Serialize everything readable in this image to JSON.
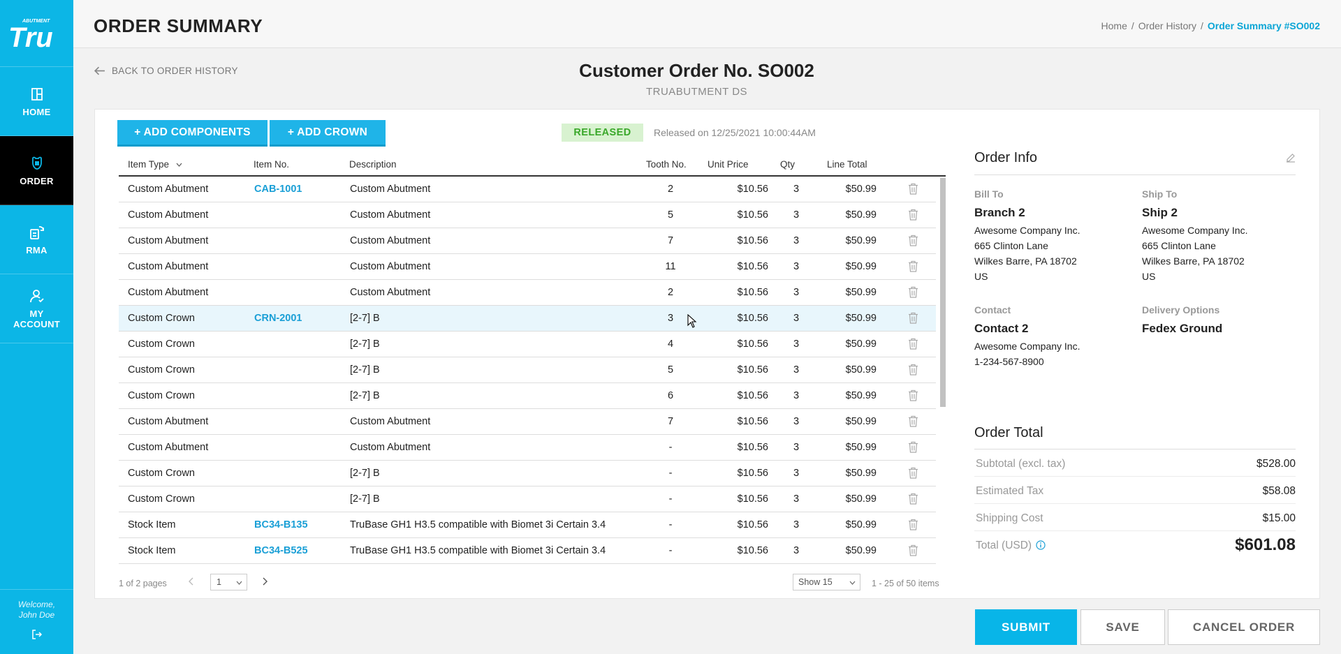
{
  "brand": {
    "logo_text": "Tru",
    "logo_small": "ABUTMENT",
    "accent": "#0cb6e6",
    "link_color": "#1a9fd6"
  },
  "nav": {
    "items": [
      {
        "label": "HOME",
        "icon": "home-icon"
      },
      {
        "label": "ORDER",
        "icon": "order-icon",
        "active": true
      },
      {
        "label": "RMA",
        "icon": "rma-icon"
      },
      {
        "label": "MY ACCOUNT",
        "icon": "account-icon"
      }
    ],
    "welcome_line1": "Welcome,",
    "welcome_line2": "John Doe"
  },
  "header": {
    "title": "ORDER SUMMARY",
    "breadcrumb": [
      "Home",
      "Order History",
      "Order Summary #SO002"
    ],
    "breadcrumb_sep": "/"
  },
  "subheader": {
    "back_label": "BACK TO ORDER HISTORY",
    "order_title": "Customer Order No. SO002",
    "customer": "TRUABUTMENT DS"
  },
  "toolbar": {
    "add_components": "+ ADD COMPONENTS",
    "add_crown": "+ ADD CROWN",
    "status": "RELEASED",
    "status_color": "#3aa82a",
    "released_on": "Released on 12/25/2021 10:00:44AM"
  },
  "table": {
    "headers": {
      "item_type": "Item Type",
      "item_no": "Item No.",
      "description": "Description",
      "tooth_no": "Tooth No.",
      "unit_price": "Unit Price",
      "qty": "Qty",
      "line_total": "Line Total"
    },
    "rows": [
      {
        "type": "Custom Abutment",
        "item": "CAB-1001",
        "desc": "Custom Abutment",
        "tooth": "2",
        "price": "$10.56",
        "qty": "3",
        "total": "$50.99"
      },
      {
        "type": "Custom Abutment",
        "item": "",
        "desc": "Custom Abutment",
        "tooth": "5",
        "price": "$10.56",
        "qty": "3",
        "total": "$50.99"
      },
      {
        "type": "Custom Abutment",
        "item": "",
        "desc": "Custom Abutment",
        "tooth": "7",
        "price": "$10.56",
        "qty": "3",
        "total": "$50.99"
      },
      {
        "type": "Custom Abutment",
        "item": "",
        "desc": "Custom Abutment",
        "tooth": "11",
        "price": "$10.56",
        "qty": "3",
        "total": "$50.99"
      },
      {
        "type": "Custom Abutment",
        "item": "",
        "desc": "Custom Abutment",
        "tooth": "2",
        "price": "$10.56",
        "qty": "3",
        "total": "$50.99"
      },
      {
        "type": "Custom Crown",
        "item": "CRN-2001",
        "desc": "[2-7] B",
        "tooth": "3",
        "price": "$10.56",
        "qty": "3",
        "total": "$50.99",
        "highlight": true
      },
      {
        "type": "Custom Crown",
        "item": "",
        "desc": "[2-7] B",
        "tooth": "4",
        "price": "$10.56",
        "qty": "3",
        "total": "$50.99"
      },
      {
        "type": "Custom Crown",
        "item": "",
        "desc": "[2-7] B",
        "tooth": "5",
        "price": "$10.56",
        "qty": "3",
        "total": "$50.99"
      },
      {
        "type": "Custom Crown",
        "item": "",
        "desc": "[2-7] B",
        "tooth": "6",
        "price": "$10.56",
        "qty": "3",
        "total": "$50.99"
      },
      {
        "type": "Custom Abutment",
        "item": "",
        "desc": "Custom Abutment",
        "tooth": "7",
        "price": "$10.56",
        "qty": "3",
        "total": "$50.99"
      },
      {
        "type": "Custom Abutment",
        "item": "",
        "desc": "Custom Abutment",
        "tooth": "-",
        "price": "$10.56",
        "qty": "3",
        "total": "$50.99"
      },
      {
        "type": "Custom Crown",
        "item": "",
        "desc": "[2-7] B",
        "tooth": "-",
        "price": "$10.56",
        "qty": "3",
        "total": "$50.99"
      },
      {
        "type": "Custom Crown",
        "item": "",
        "desc": "[2-7] B",
        "tooth": "-",
        "price": "$10.56",
        "qty": "3",
        "total": "$50.99"
      },
      {
        "type": "Stock Item",
        "item": "BC34-B135",
        "desc": "TruBase GH1 H3.5 compatible with Biomet 3i Certain 3.4",
        "tooth": "-",
        "price": "$10.56",
        "qty": "3",
        "total": "$50.99"
      },
      {
        "type": "Stock Item",
        "item": "BC34-B525",
        "desc": "TruBase GH1 H3.5 compatible with Biomet 3i Certain 3.4",
        "tooth": "-",
        "price": "$10.56",
        "qty": "3",
        "total": "$50.99"
      }
    ],
    "pages_text": "1 of 2 pages",
    "page_value": "1",
    "show_value": "Show 15",
    "items_text": "1 - 25 of 50 items"
  },
  "order_info": {
    "title": "Order Info",
    "bill_to_label": "Bill To",
    "bill_to_name": "Branch 2",
    "bill_to_lines": [
      "Awesome Company Inc.",
      "665 Clinton Lane",
      "Wilkes Barre, PA 18702",
      "US"
    ],
    "ship_to_label": "Ship To",
    "ship_to_name": "Ship 2",
    "ship_to_lines": [
      "Awesome Company Inc.",
      "665 Clinton Lane",
      "Wilkes Barre, PA 18702",
      "US"
    ],
    "contact_label": "Contact",
    "contact_name": "Contact 2",
    "contact_lines": [
      "Awesome Company Inc.",
      "1-234-567-8900"
    ],
    "delivery_label": "Delivery Options",
    "delivery_value": "Fedex Ground"
  },
  "order_total": {
    "title": "Order Total",
    "subtotal_label": "Subtotal (excl. tax)",
    "subtotal": "$528.00",
    "tax_label": "Estimated Tax",
    "tax": "$58.08",
    "shipping_label": "Shipping Cost",
    "shipping": "$15.00",
    "total_label": "Total (USD)",
    "total": "$601.08"
  },
  "actions": {
    "submit": "SUBMIT",
    "save": "SAVE",
    "cancel": "CANCEL ORDER"
  }
}
